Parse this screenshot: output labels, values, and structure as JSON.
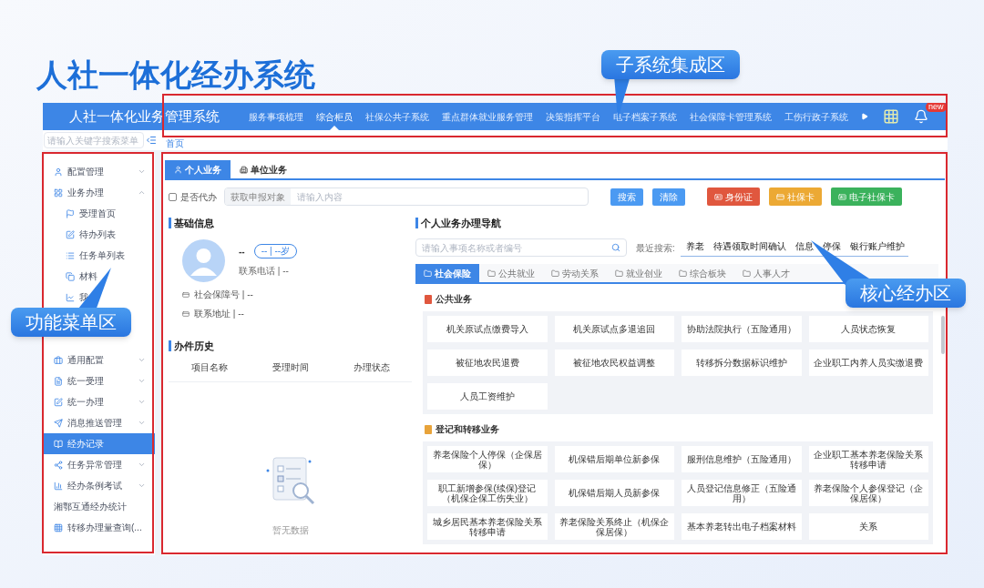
{
  "slide": {
    "title": "人社一体化经办系统",
    "callouts": [
      {
        "label": "子系统集成区"
      },
      {
        "label": "功能菜单区"
      },
      {
        "label": "核心经办区"
      }
    ]
  },
  "header": {
    "title": "人社一体化业务管理系统",
    "nav": [
      {
        "label": "服务事项梳理",
        "selected": false
      },
      {
        "label": "综合柜员",
        "selected": true
      },
      {
        "label": "社保公共子系统",
        "selected": false
      },
      {
        "label": "重点群体就业服务管理",
        "selected": false
      },
      {
        "label": "决策指挥平台",
        "selected": false
      },
      {
        "label": "电子档案子系统",
        "selected": false
      },
      {
        "label": "社会保障卡管理系统",
        "selected": false
      },
      {
        "label": "工伤行政子系统",
        "selected": false
      }
    ],
    "badge": "new"
  },
  "sidebar": {
    "search_placeholder": "请输入关键字搜索菜单",
    "items": [
      {
        "label": "配置管理",
        "expanded": false,
        "selected": false
      },
      {
        "label": "业务办理",
        "expanded": true,
        "selected": false,
        "children": [
          {
            "label": "受理首页"
          },
          {
            "label": "待办列表"
          },
          {
            "label": "任务单列表"
          },
          {
            "label": "材料"
          },
          {
            "label": "我"
          }
        ]
      },
      {
        "label": "通用配置",
        "expanded": false,
        "selected": false
      },
      {
        "label": "统一受理",
        "expanded": false,
        "selected": false
      },
      {
        "label": "统一办理",
        "expanded": false,
        "selected": false
      },
      {
        "label": "消息推送管理",
        "expanded": false,
        "selected": false
      },
      {
        "label": "经办记录",
        "selected": true
      },
      {
        "label": "任务异常管理",
        "expanded": false,
        "selected": false
      },
      {
        "label": "经办条例考试",
        "expanded": false,
        "selected": false
      },
      {
        "label": "湘鄂互通经办统计",
        "selected": false
      },
      {
        "label": "转移办理量查询(...",
        "selected": false
      }
    ]
  },
  "breadcrumb": "首页",
  "tabs": [
    {
      "label": "个人业务",
      "selected": true
    },
    {
      "label": "单位业务",
      "selected": false
    }
  ],
  "query": {
    "proxy_label": "是否代办",
    "checked": false,
    "prefix": "获取申报对象",
    "placeholder": "请输入内容",
    "actions": [
      {
        "label": "搜索"
      },
      {
        "label": "清除"
      }
    ],
    "cards": [
      {
        "label": "身份证",
        "color": "#e0573e"
      },
      {
        "label": "社保卡",
        "color": "#eca934"
      },
      {
        "label": "电子社保卡",
        "color": "#3bb25c"
      }
    ]
  },
  "basic_info": {
    "title": "基础信息",
    "name": "--",
    "age": "-- | --岁",
    "phone": "联系电话 | --",
    "fields": [
      "社会保障号 | --",
      "联系地址 | --"
    ]
  },
  "history": {
    "title": "办件历史",
    "columns": [
      "项目名称",
      "受理时间",
      "办理状态"
    ],
    "empty": "暂无数据"
  },
  "navigator": {
    "title": "个人业务办理导航",
    "search_placeholder": "请输入事项名称或者编号",
    "recent_label": "最近搜索:",
    "recent": [
      "养老",
      "待遇领取时间确认",
      "信息",
      "停保",
      "银行账户维护"
    ],
    "categories": [
      {
        "label": "社会保险",
        "selected": true
      },
      {
        "label": "公共就业",
        "selected": false
      },
      {
        "label": "劳动关系",
        "selected": false
      },
      {
        "label": "就业创业",
        "selected": false
      },
      {
        "label": "综合板块",
        "selected": false
      },
      {
        "label": "人事人才",
        "selected": false
      }
    ],
    "sections": [
      {
        "title": "公共业务",
        "color": "#e0573e",
        "items": [
          "机关原试点缴费导入",
          "机关原试点多退追回",
          "协助法院执行（五险通用）",
          "人员状态恢复",
          "被征地农民退费",
          "被征地农民权益调整",
          "转移拆分数据标识维护",
          "企业职工内养人员实缴退费",
          "人员工资维护"
        ]
      },
      {
        "title": "登记和转移业务",
        "color": "#e8a33a",
        "items": [
          "养老保险个人停保（企保居保）",
          "机保错后期单位新参保",
          "服刑信息维护（五险通用）",
          "企业职工基本养老保险关系转移申请",
          "职工新增参保(续保)登记（机保企保工伤失业）",
          "机保错后期人员新参保",
          "人员登记信息修正（五险通用）",
          "养老保险个人参保登记（企保居保）",
          "城乡居民基本养老保险关系转移申请",
          "养老保险关系终止（机保企保居保）",
          "基本养老转出电子档案材料",
          "关系"
        ]
      }
    ]
  }
}
